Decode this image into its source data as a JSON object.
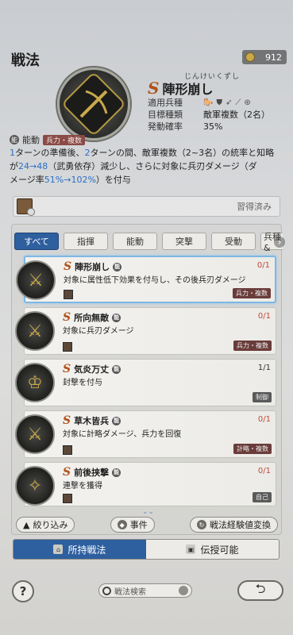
{
  "header": {
    "title": "戦法",
    "currency_value": "912",
    "currency_icon": "coin-icon"
  },
  "skill": {
    "grade": "S",
    "furigana": "じんけいくずし",
    "name": "陣形崩し",
    "info": [
      {
        "label": "適用兵種",
        "value": ""
      },
      {
        "label": "目標種類",
        "value": "敵軍複数（2名）"
      },
      {
        "label": "発動確率",
        "value": "35%"
      }
    ],
    "type_label": "能動",
    "type_badge": "兵力・複数",
    "desc_l1_a": "1",
    "desc_l1_b": "ターンの準備後、",
    "desc_l1_c": "2",
    "desc_l1_d": "ターンの間、敵軍複数（2~3名）の統率と知略",
    "desc_l2_a": "が",
    "desc_l2_b": "24→48",
    "desc_l2_c": "（武勇依存）減少し、さらに対象に兵刃ダメージ（ダ",
    "desc_l3_a": "メージ率",
    "desc_l3_b": "51%→102%",
    "desc_l3_c": "）を付与"
  },
  "owner": {
    "status": "習得済み"
  },
  "tabs": [
    "すべて",
    "指揮",
    "能動",
    "突撃",
    "受動",
    "兵種&"
  ],
  "list": [
    {
      "grade": "S",
      "name": "陣形崩し",
      "desc": "対象に属性低下効果を付与し、その後兵刃ダメージ",
      "count": "0/1",
      "tag": "兵力・複数"
    },
    {
      "grade": "S",
      "name": "所向無敵",
      "desc": "対象に兵刃ダメージ",
      "count": "0/1",
      "tag": "兵力・複数"
    },
    {
      "grade": "S",
      "name": "気炎万丈",
      "desc": "封撃を付与",
      "count": "1/1",
      "tag": "制御"
    },
    {
      "grade": "S",
      "name": "草木皆兵",
      "desc": "対象に計略ダメージ、兵力を回復",
      "count": "0/1",
      "tag": "計略・複数"
    },
    {
      "grade": "S",
      "name": "前後挟撃",
      "desc": "連撃を獲得",
      "count": "0/1",
      "tag": "自己"
    }
  ],
  "actions": {
    "filter": "絞り込み",
    "event": "事件",
    "exchange": "戦法経験値変換"
  },
  "bottom_tabs": {
    "owned": "所持戦法",
    "transferable": "伝授可能"
  },
  "footer": {
    "help": "?",
    "search_placeholder": "戦法検索",
    "back": "⮌"
  }
}
